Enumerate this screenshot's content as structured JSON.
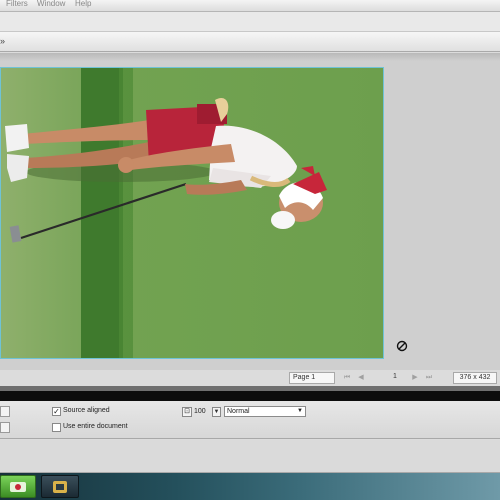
{
  "menubar": {
    "items": [
      "Filters",
      "Window",
      "Help"
    ]
  },
  "document_tab": {
    "glyph": "»"
  },
  "statusbar": {
    "page_label": "Page 1",
    "page_number": "1",
    "image_size": "376 x 432",
    "nav_first": "⏮",
    "nav_prev": "◀",
    "nav_next": "▶",
    "nav_last": "⏭"
  },
  "options": {
    "source_aligned_label": "Source aligned",
    "source_aligned_checked": "✓",
    "use_entire_document_label": "Use entire document",
    "brush_size": "100",
    "blend_mode": "Normal"
  },
  "icons": {
    "cursor": "no-entry-cursor-icon",
    "stamp": "clone-stamp-icon",
    "taskbar_app_1": "photoshop-elements-icon",
    "taskbar_app_2": "organizer-icon"
  },
  "colors": {
    "selection_outline": "#6fc3d6",
    "turf": "#6f9e4f",
    "taskbar_active": "#4ca12f"
  }
}
